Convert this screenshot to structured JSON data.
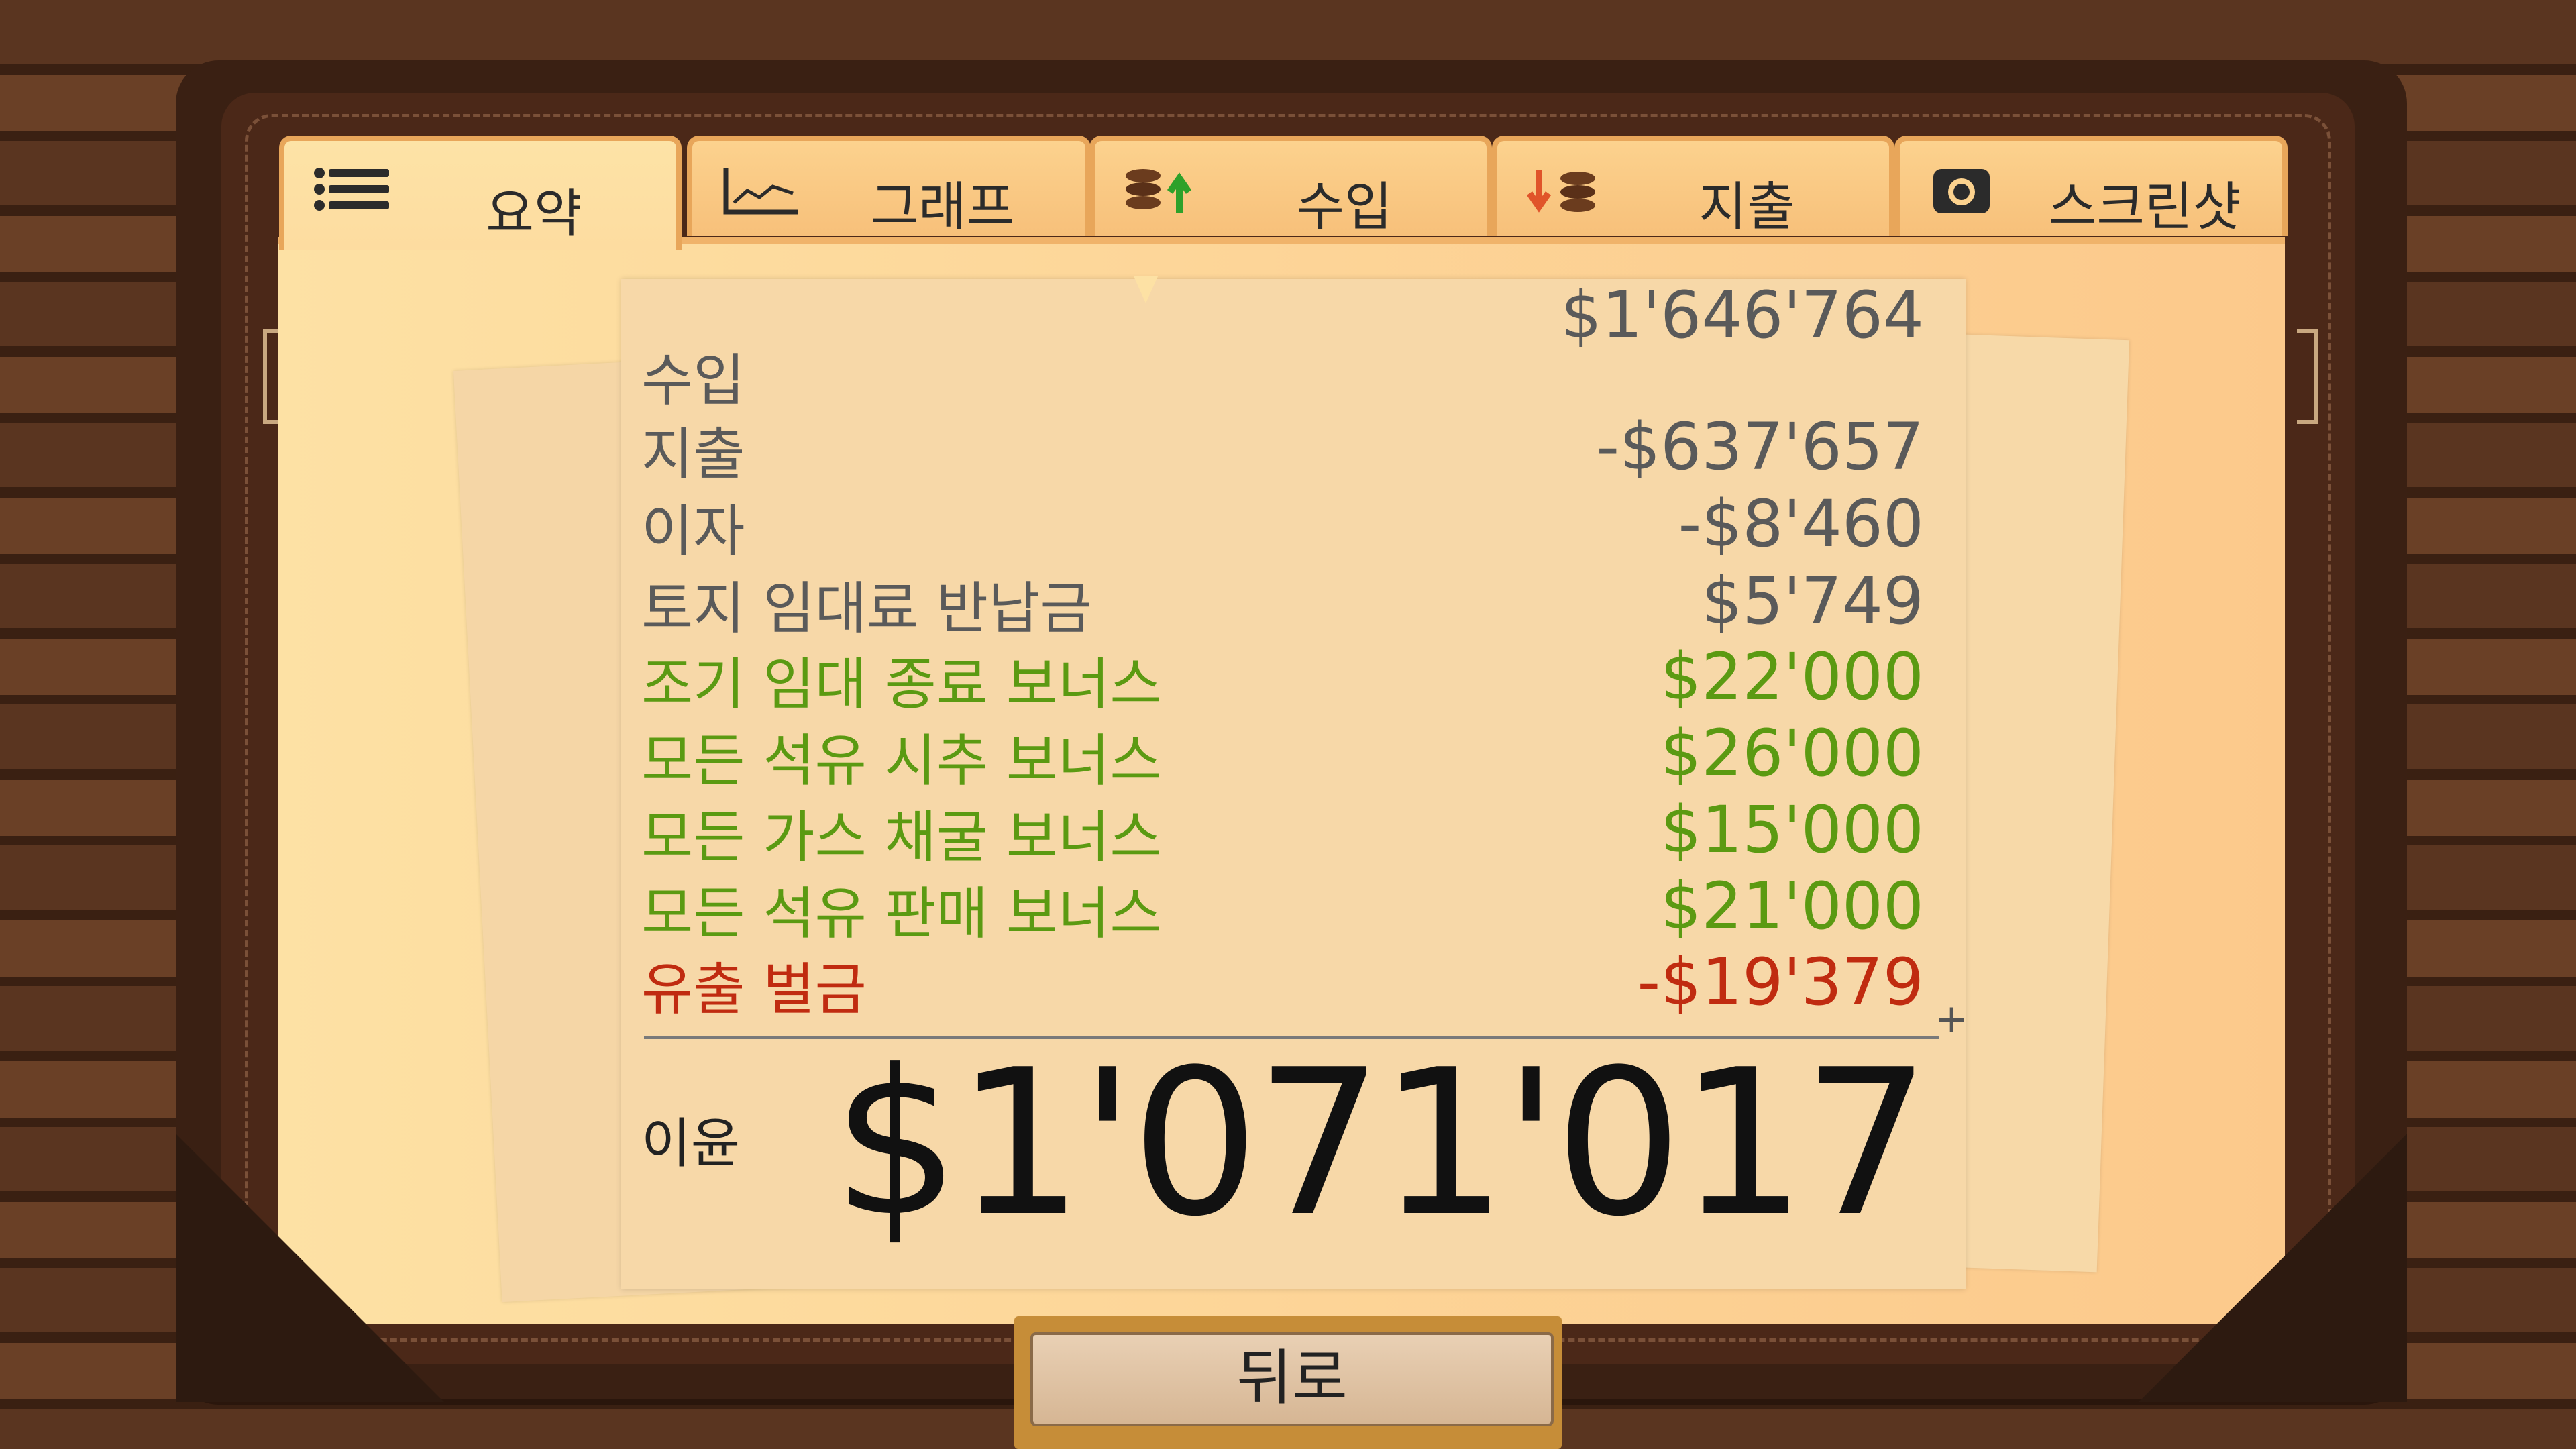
{
  "tabs": [
    {
      "label": "요약",
      "icon": "list-icon",
      "active": true
    },
    {
      "label": "그래프",
      "icon": "line-chart-icon",
      "active": false
    },
    {
      "label": "수입",
      "icon": "coins-up-icon",
      "active": false
    },
    {
      "label": "지출",
      "icon": "coins-down-icon",
      "active": false
    },
    {
      "label": "스크린샷",
      "icon": "camera-icon",
      "active": false
    }
  ],
  "summary": {
    "income": {
      "label": "수입",
      "value": "$1'646'764"
    },
    "expenses": {
      "label": "지출",
      "value": "-$637'657"
    },
    "interest": {
      "label": "이자",
      "value": "-$8'460"
    },
    "land_refund": {
      "label": "토지 임대료 반납금",
      "value": "$5'749"
    },
    "early_lease_bonus": {
      "label": "조기 임대 종료 보너스",
      "value": "$22'000"
    },
    "oil_drilling_bonus": {
      "label": "모든 석유 시추 보너스",
      "value": "$26'000"
    },
    "gas_mining_bonus": {
      "label": "모든 가스 채굴 보너스",
      "value": "$15'000"
    },
    "oil_sales_bonus": {
      "label": "모든 석유 판매 보너스",
      "value": "$21'000"
    },
    "spill_fine": {
      "label": "유출 벌금",
      "value": "-$19'379"
    },
    "plus_sign": "+",
    "profit": {
      "label": "이윤",
      "value": "$1'071'017"
    }
  },
  "colors": {
    "bonus": "#5b9a12",
    "penalty": "#c02b10",
    "neutral": "#5a5a5a"
  },
  "back_button": {
    "label": "뒤로"
  }
}
